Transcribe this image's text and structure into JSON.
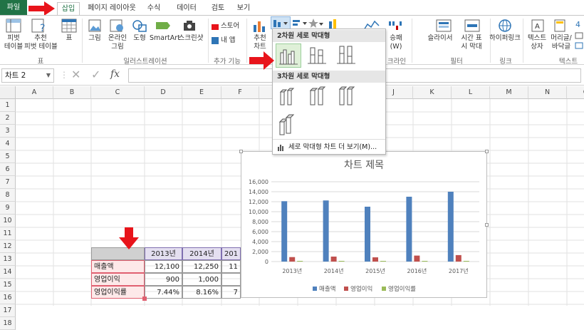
{
  "tabs": {
    "file": "파일",
    "insert": "삽입",
    "layout": "페이지 레이아웃",
    "formulas": "수식",
    "data": "데이터",
    "review": "검토",
    "view": "보기"
  },
  "ribbon": {
    "pivot": "피벗\n테이블",
    "recommended_pivot": "추천\n피벗 테이블",
    "table": "표",
    "group_tables": "표",
    "picture": "그림",
    "online_picture": "온라인\n그림",
    "shapes": "도형",
    "smartart": "SmartArt",
    "screenshot": "스크린샷",
    "group_illustrations": "일러스트레이션",
    "store": "스토어",
    "my_apps": "내 앱",
    "group_addins": "추가 기능",
    "recommended_charts": "추천\n차트",
    "sparkline_line_partial": "선",
    "winloss": "승패\n(W)",
    "group_sparklines_partial": "크라인",
    "slicer": "슬라이서",
    "timeline": "시간 표\n시 막대",
    "group_filters": "필터",
    "hyperlink": "하이퍼링크",
    "group_links": "링크",
    "textbox": "텍스트\n상자",
    "header_footer": "머리글/\n바닥글",
    "group_text": "텍스트"
  },
  "formula_bar": {
    "name_box": "차트 2",
    "fx": "fx"
  },
  "dropdown": {
    "section_2d": "2차원 세로 막대형",
    "section_3d": "3차원 세로 막대형",
    "more_charts": "세로 막대형 차트 더 보기(M)..."
  },
  "columns": [
    "A",
    "B",
    "C",
    "D",
    "E",
    "F",
    "G",
    "H",
    "I",
    "J",
    "K",
    "L",
    "M",
    "N",
    "O"
  ],
  "rows": [
    "1",
    "2",
    "3",
    "4",
    "5",
    "6",
    "7",
    "8",
    "9",
    "10",
    "11",
    "12",
    "13",
    "14",
    "15",
    "16",
    "17",
    "18"
  ],
  "table": {
    "headers": [
      "2013년",
      "2014년",
      "201"
    ],
    "rows": [
      {
        "label": "매출액",
        "values": [
          "12,100",
          "12,250",
          "11"
        ]
      },
      {
        "label": "영업이익",
        "values": [
          "900",
          "1,000",
          ""
        ]
      },
      {
        "label": "영업이익률",
        "values": [
          "7.44%",
          "8.16%",
          "7"
        ]
      }
    ]
  },
  "chart_data": {
    "type": "bar",
    "title": "차트 제목",
    "categories": [
      "2013년",
      "2014년",
      "2015년",
      "2016년",
      "2017년"
    ],
    "series": [
      {
        "name": "매출액",
        "values": [
          12100,
          12250,
          11000,
          13000,
          14000
        ],
        "color": "#4f81bd"
      },
      {
        "name": "영업이익",
        "values": [
          900,
          1000,
          850,
          1200,
          1300
        ],
        "color": "#c0504d"
      },
      {
        "name": "영업이익률",
        "values": [
          0.07,
          0.08,
          0.07,
          0.08,
          0.09
        ],
        "color": "#9bbb59"
      }
    ],
    "yticks": [
      "0",
      "2,000",
      "4,000",
      "6,000",
      "8,000",
      "10,000",
      "12,000",
      "14,000",
      "16,000"
    ],
    "ylim": [
      0,
      16000
    ],
    "grid": true,
    "legend": "bottom"
  },
  "colors": {
    "excel_green": "#217346",
    "arrow_red": "#e8141b",
    "header_fill": "#e4dff0",
    "row_fill": "#fde9e9"
  }
}
